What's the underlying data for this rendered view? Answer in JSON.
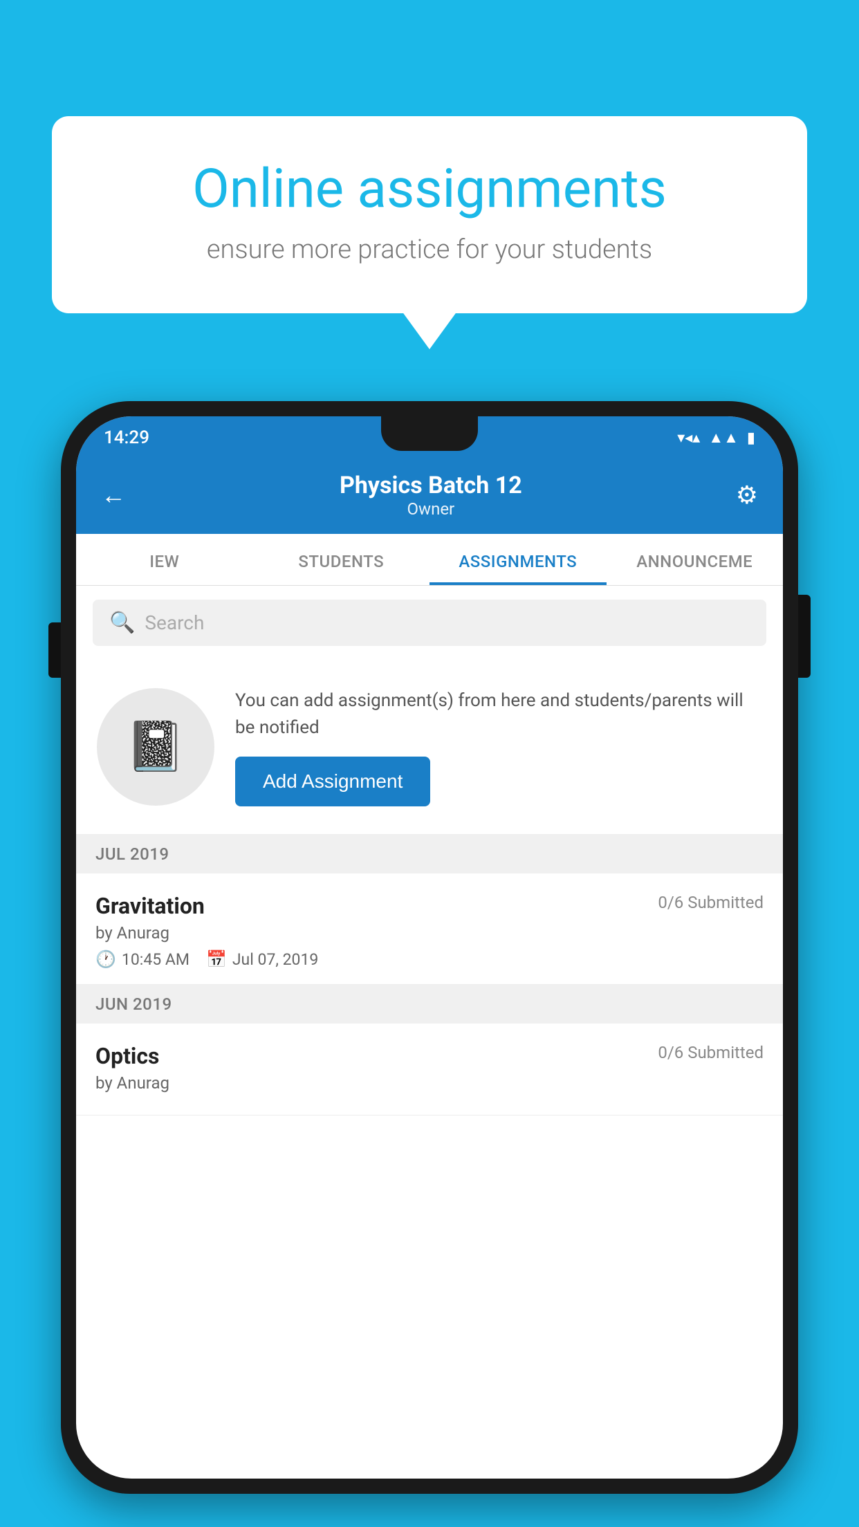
{
  "background_color": "#1BB8E8",
  "speech_bubble": {
    "title": "Online assignments",
    "subtitle": "ensure more practice for your students"
  },
  "phone": {
    "status_bar": {
      "time": "14:29",
      "wifi_icon": "wifi",
      "signal_icon": "signal",
      "battery_icon": "battery"
    },
    "header": {
      "title": "Physics Batch 12",
      "subtitle": "Owner",
      "back_label": "←",
      "settings_label": "⚙"
    },
    "tabs": [
      {
        "label": "IEW",
        "active": false
      },
      {
        "label": "STUDENTS",
        "active": false
      },
      {
        "label": "ASSIGNMENTS",
        "active": true
      },
      {
        "label": "ANNOUNCEME",
        "active": false
      }
    ],
    "search": {
      "placeholder": "Search"
    },
    "add_section": {
      "description": "You can add assignment(s) from here and students/parents will be notified",
      "button_label": "Add Assignment"
    },
    "month_sections": [
      {
        "month_label": "JUL 2019",
        "assignments": [
          {
            "name": "Gravitation",
            "submitted": "0/6 Submitted",
            "by": "by Anurag",
            "time": "10:45 AM",
            "date": "Jul 07, 2019"
          }
        ]
      },
      {
        "month_label": "JUN 2019",
        "assignments": [
          {
            "name": "Optics",
            "submitted": "0/6 Submitted",
            "by": "by Anurag",
            "time": "",
            "date": ""
          }
        ]
      }
    ]
  }
}
